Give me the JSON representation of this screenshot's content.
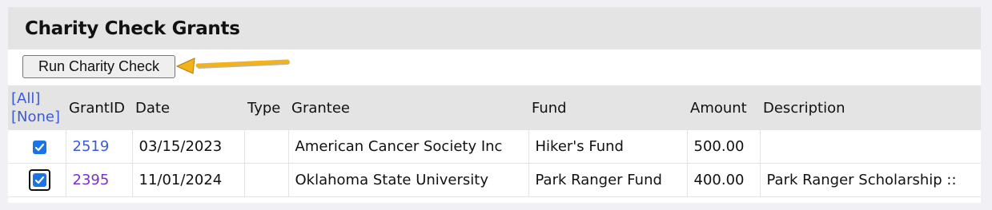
{
  "panel": {
    "title": "Charity Check Grants"
  },
  "toolbar": {
    "run_button_label": "Run Charity Check"
  },
  "table": {
    "select_all_label": "[All]",
    "select_none_label": "[None]",
    "headers": {
      "grant_id": "GrantID",
      "date": "Date",
      "type": "Type",
      "grantee": "Grantee",
      "fund": "Fund",
      "amount": "Amount",
      "description": "Description"
    },
    "rows": [
      {
        "checked": true,
        "grant_id": "2519",
        "date": "03/15/2023",
        "type": "",
        "grantee": "American Cancer Society Inc",
        "fund": "Hiker's Fund",
        "amount": "500.00",
        "description": ""
      },
      {
        "checked": true,
        "grant_id": "2395",
        "date": "11/01/2024",
        "type": "",
        "grantee": "Oklahoma State University",
        "fund": "Park Ranger Fund",
        "amount": "400.00",
        "description": "Park Ranger Scholarship ::"
      }
    ]
  },
  "colors": {
    "accent_checkbox": "#1a73e8",
    "link_blue": "#3b5bd6",
    "link_purple": "#7b2fc8",
    "arrow": "#f2b21a"
  },
  "icons": {
    "annotation_arrow": "arrow-left-icon",
    "checkbox": "checkmark-icon"
  }
}
